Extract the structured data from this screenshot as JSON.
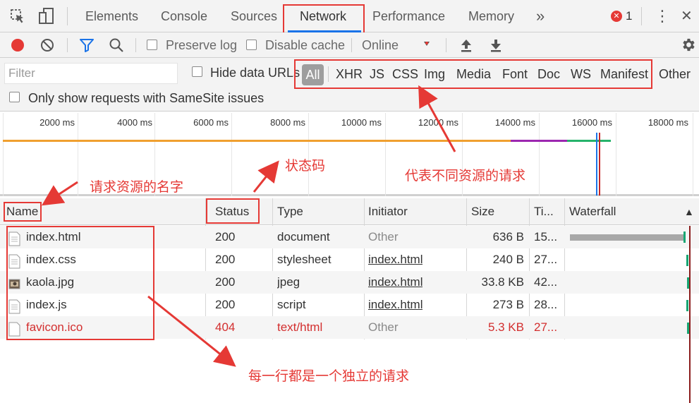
{
  "devtools": {
    "tabs": [
      "Elements",
      "Console",
      "Sources",
      "Network",
      "Performance",
      "Memory"
    ],
    "more_tabs": "»",
    "error_count": "1",
    "kebab": "⋮",
    "close": "✕"
  },
  "toolbar": {
    "preserve_log": "Preserve log",
    "disable_cache": "Disable cache",
    "throttle": "Online"
  },
  "filter": {
    "placeholder": "Filter",
    "hide_data_urls": "Hide data URLs",
    "types": [
      "All",
      "XHR",
      "JS",
      "CSS",
      "Img",
      "Media",
      "Font",
      "Doc",
      "WS",
      "Manifest",
      "Other"
    ],
    "samesite": "Only show requests with SameSite issues"
  },
  "overview": {
    "ticks": [
      "2000 ms",
      "4000 ms",
      "6000 ms",
      "8000 ms",
      "10000 ms",
      "12000 ms",
      "14000 ms",
      "16000 ms",
      "18000 ms"
    ]
  },
  "table": {
    "headers": [
      "Name",
      "Status",
      "Type",
      "Initiator",
      "Size",
      "Ti...",
      "Waterfall"
    ],
    "sort_indicator": "▲",
    "rows": [
      {
        "name": "index.html",
        "status": "200",
        "type": "document",
        "initiator": "Other",
        "size": "636 B",
        "time": "15..."
      },
      {
        "name": "index.css",
        "status": "200",
        "type": "stylesheet",
        "initiator": "index.html",
        "size": "240 B",
        "time": "27..."
      },
      {
        "name": "kaola.jpg",
        "status": "200",
        "type": "jpeg",
        "initiator": "index.html",
        "size": "33.8 KB",
        "time": "42..."
      },
      {
        "name": "index.js",
        "status": "200",
        "type": "script",
        "initiator": "index.html",
        "size": "273 B",
        "time": "28..."
      },
      {
        "name": "favicon.ico",
        "status": "404",
        "type": "text/html",
        "initiator": "Other",
        "size": "5.3 KB",
        "time": "27..."
      }
    ]
  },
  "annotations": {
    "name_label": "请求资源的名字",
    "status_label": "状态码",
    "types_label": "代表不同资源的请求",
    "rows_label": "每一行都是一个独立的请求"
  },
  "colors": {
    "accent": "#1a73e8",
    "annotation_red": "#e53935",
    "record_red": "#e53935",
    "error_text": "#d32f2f"
  }
}
